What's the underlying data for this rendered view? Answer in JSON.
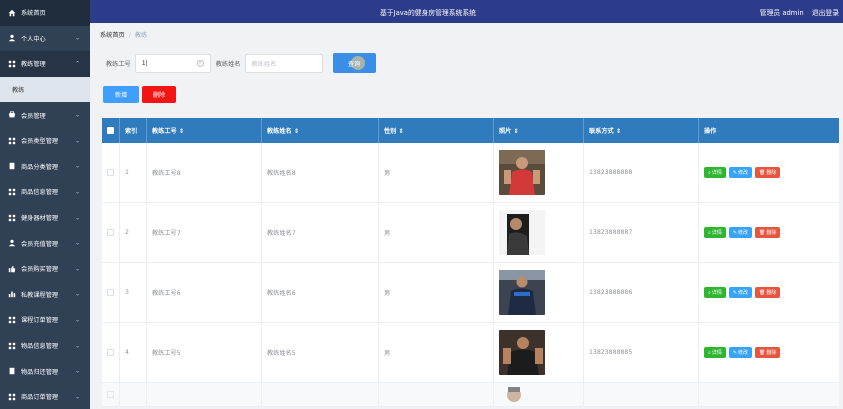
{
  "header": {
    "title": "基于Java的健身房管理系统系统",
    "user": "管理员 admin",
    "logout": "退出登录"
  },
  "sidebar": {
    "items": [
      {
        "label": "系统首页",
        "icon": "home-icon",
        "state": "home"
      },
      {
        "label": "个人中心",
        "icon": "user-icon"
      },
      {
        "label": "教练管理",
        "icon": "grid-icon",
        "state": "active",
        "expanded": true
      },
      {
        "label": "会员管理",
        "icon": "cart-icon"
      },
      {
        "label": "会员类型管理",
        "icon": "grid-icon"
      },
      {
        "label": "商品分类管理",
        "icon": "doc-icon"
      },
      {
        "label": "商品信息管理",
        "icon": "grid-icon"
      },
      {
        "label": "健身器材管理",
        "icon": "grid-icon"
      },
      {
        "label": "会员充值管理",
        "icon": "user-icon"
      },
      {
        "label": "会员购买管理",
        "icon": "thumb-icon"
      },
      {
        "label": "私教课程管理",
        "icon": "chart-icon"
      },
      {
        "label": "课程订单管理",
        "icon": "grid-icon"
      },
      {
        "label": "物品信息管理",
        "icon": "grid-icon"
      },
      {
        "label": "物品归还管理",
        "icon": "doc-icon"
      },
      {
        "label": "商品订单管理",
        "icon": "grid-icon"
      }
    ],
    "sub_item": "教练"
  },
  "breadcrumb": {
    "home": "系统首页",
    "current": "教练"
  },
  "search": {
    "coach_no_label": "教练工号",
    "coach_no_value": "1|",
    "coach_name_label": "教练姓名",
    "coach_name_placeholder": "教练姓名",
    "query_button": "查询"
  },
  "actions": {
    "add": "新增",
    "delete": "删除"
  },
  "table": {
    "headers": [
      "索引",
      "教练工号 ⇕",
      "教练姓名 ⇕",
      "性别 ⇕",
      "照片 ⇕",
      "联系方式 ⇕",
      "操作"
    ],
    "rows": [
      {
        "idx": "1",
        "no": "教练工号8",
        "name": "教练姓名8",
        "sex": "男",
        "tel": "13823888888"
      },
      {
        "idx": "2",
        "no": "教练工号7",
        "name": "教练姓名7",
        "sex": "男",
        "tel": "13823888887"
      },
      {
        "idx": "3",
        "no": "教练工号6",
        "name": "教练姓名6",
        "sex": "男",
        "tel": "13823888886"
      },
      {
        "idx": "4",
        "no": "教练工号5",
        "name": "教练姓名5",
        "sex": "男",
        "tel": "13823888885"
      }
    ],
    "ops": {
      "detail": "详情",
      "edit": "修改",
      "remove": "删除"
    }
  },
  "colors": {
    "sidebar": "#304156",
    "header": "#2c3b8a",
    "table_header": "#2f7bbd",
    "primary": "#409eff",
    "danger": "#f31414",
    "success": "#2fb52f"
  }
}
